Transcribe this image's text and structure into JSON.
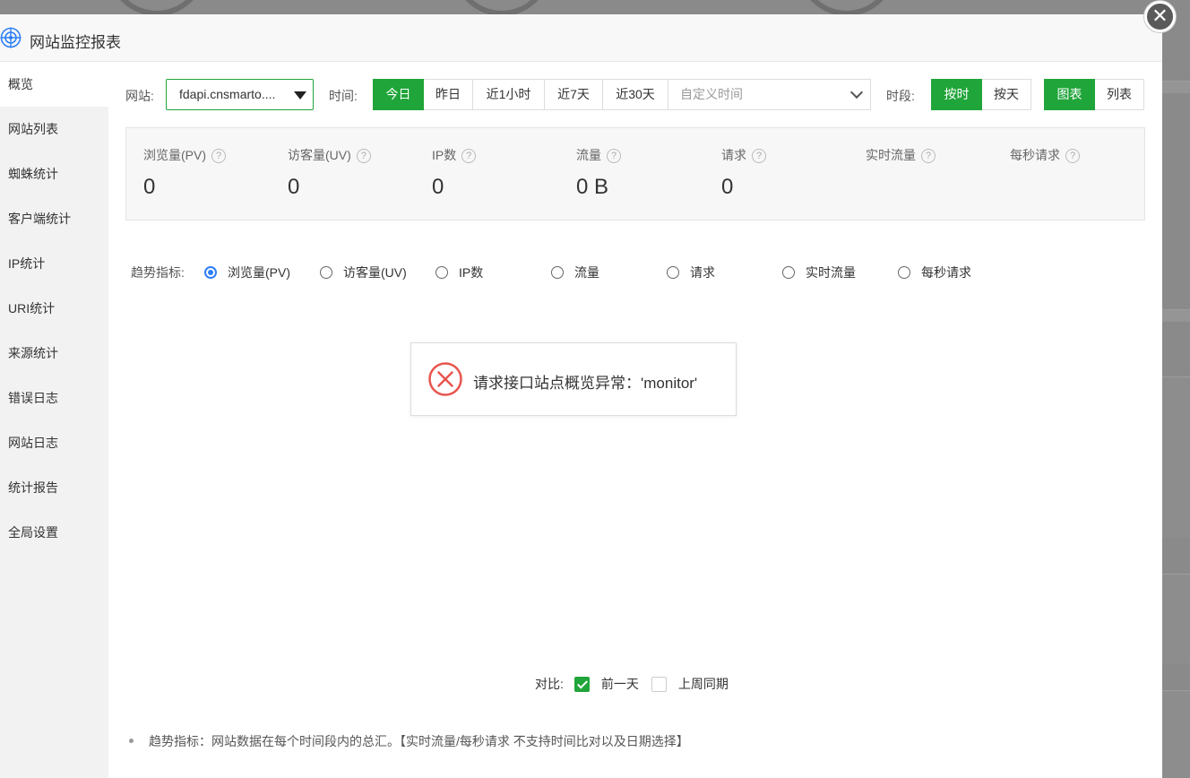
{
  "dialog": {
    "title": "网站监控报表",
    "close_symbol": "✕"
  },
  "sidebar": {
    "items": [
      {
        "label": "概览",
        "active": true
      },
      {
        "label": "网站列表"
      },
      {
        "label": "蜘蛛统计"
      },
      {
        "label": "客户端统计"
      },
      {
        "label": "IP统计"
      },
      {
        "label": "URI统计"
      },
      {
        "label": "来源统计"
      },
      {
        "label": "错误日志"
      },
      {
        "label": "网站日志"
      },
      {
        "label": "统计报告"
      },
      {
        "label": "全局设置"
      }
    ]
  },
  "toolbar": {
    "site_label": "网站:",
    "site_value": "fdapi.cnsmarto....",
    "time_label": "时间:",
    "time_buttons": [
      "今日",
      "昨日",
      "近1小时",
      "近7天",
      "近30天"
    ],
    "time_active": "今日",
    "custom_time_placeholder": "自定义时间",
    "period_label": "时段:",
    "period_buttons": [
      "按时",
      "按天"
    ],
    "period_active": "按时",
    "view_buttons": [
      "图表",
      "列表"
    ],
    "view_active": "图表"
  },
  "stats": [
    {
      "label": "浏览量(PV)",
      "value": "0"
    },
    {
      "label": "访客量(UV)",
      "value": "0"
    },
    {
      "label": "IP数",
      "value": "0"
    },
    {
      "label": "流量",
      "value": "0 B"
    },
    {
      "label": "请求",
      "value": "0"
    },
    {
      "label": "实时流量",
      "value": ""
    },
    {
      "label": "每秒请求",
      "value": ""
    }
  ],
  "help_symbol": "?",
  "trend": {
    "label": "趋势指标:",
    "options": [
      "浏览量(PV)",
      "访客量(UV)",
      "IP数",
      "流量",
      "请求",
      "实时流量",
      "每秒请求"
    ],
    "selected": "浏览量(PV)"
  },
  "error_message": "请求接口站点概览异常：'monitor'",
  "compare": {
    "label": "对比:",
    "options": [
      {
        "label": "前一天",
        "checked": true
      },
      {
        "label": "上周同期",
        "checked": false
      }
    ]
  },
  "note": "趋势指标：网站数据在每个时间段内的总汇。【实时流量/每秒请求 不支持时间比对以及日期选择】",
  "colors": {
    "accent": "#20a53a",
    "radio": "#2d7ff9",
    "error": "#e8554e"
  }
}
